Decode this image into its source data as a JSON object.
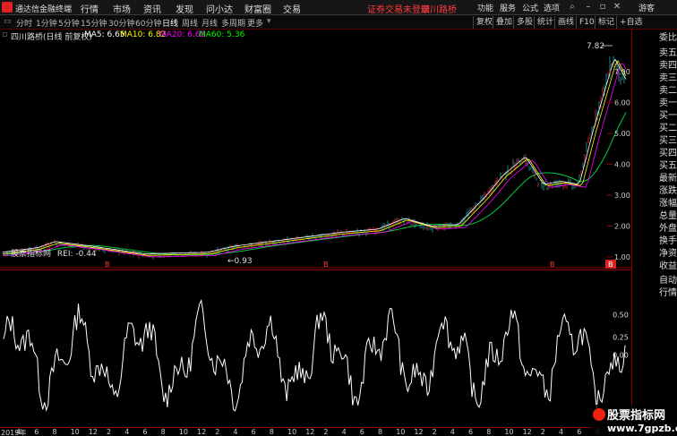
{
  "menubar": {
    "app_title": "通达信金融终端",
    "items": [
      "行情",
      "市场",
      "资讯",
      "发现",
      "问小达",
      "财富圈",
      "交易"
    ],
    "notice": "证券交易未登录",
    "stock_name": "四川路桥",
    "right_items": [
      "功能",
      "服务",
      "公式",
      "选项"
    ],
    "guest": "游客"
  },
  "periodbar": {
    "periods": [
      "分时",
      "1分钟",
      "5分钟",
      "15分钟",
      "30分钟",
      "60分钟",
      "日线",
      "周线",
      "月线",
      "多周期",
      "更多"
    ],
    "active": "日线",
    "toolbar": [
      "复权",
      "叠加",
      "多股",
      "统计",
      "画线",
      "F10",
      "标记",
      "+自选"
    ]
  },
  "info": {
    "title": "四川路桥(日线 前复权)",
    "ma5": "MA5: 6.65",
    "ma10": "MA10: 6.82",
    "ma20": "MA20: 6.65",
    "ma60": "MA60: 5.36",
    "colors": {
      "ma5": "#ffffff",
      "ma10": "#ffff00",
      "ma20": "#ff00ff",
      "ma60": "#00ff00"
    }
  },
  "kchart": {
    "price_axis": [
      "7.00",
      "6.00",
      "5.00",
      "4.00",
      "3.00",
      "2.00",
      "1.00"
    ],
    "high_label": "7.82",
    "low_label": "←0.93",
    "markers": [
      "B",
      "B",
      "B",
      "B"
    ]
  },
  "indicator": {
    "name": "股票指标网",
    "value": "REI: -0.44",
    "axis": [
      "0.50",
      "0.25",
      "0.00"
    ]
  },
  "xaxis": {
    "labels": [
      "2019年",
      "4",
      "6",
      "8",
      "10",
      "12",
      "2",
      "4",
      "6",
      "8",
      "10",
      "12",
      "2",
      "4",
      "6",
      "8",
      "10",
      "12",
      "2",
      "4",
      "6",
      "8",
      "10",
      "12",
      "2",
      "4",
      "6",
      "8",
      "10",
      "12",
      "2",
      "4",
      "6",
      "8"
    ]
  },
  "rightpanel": {
    "items": [
      "委比",
      "卖五",
      "卖四",
      "卖三",
      "卖二",
      "卖一",
      "买一",
      "买二",
      "买三",
      "买四",
      "买五",
      "最新",
      "涨跌",
      "涨幅",
      "总量",
      "外盘",
      "换手",
      "净资",
      "收益",
      "自动",
      "行情"
    ]
  },
  "watermark": {
    "line1": "股票指标网",
    "line2": "www.7gpzb.com"
  }
}
